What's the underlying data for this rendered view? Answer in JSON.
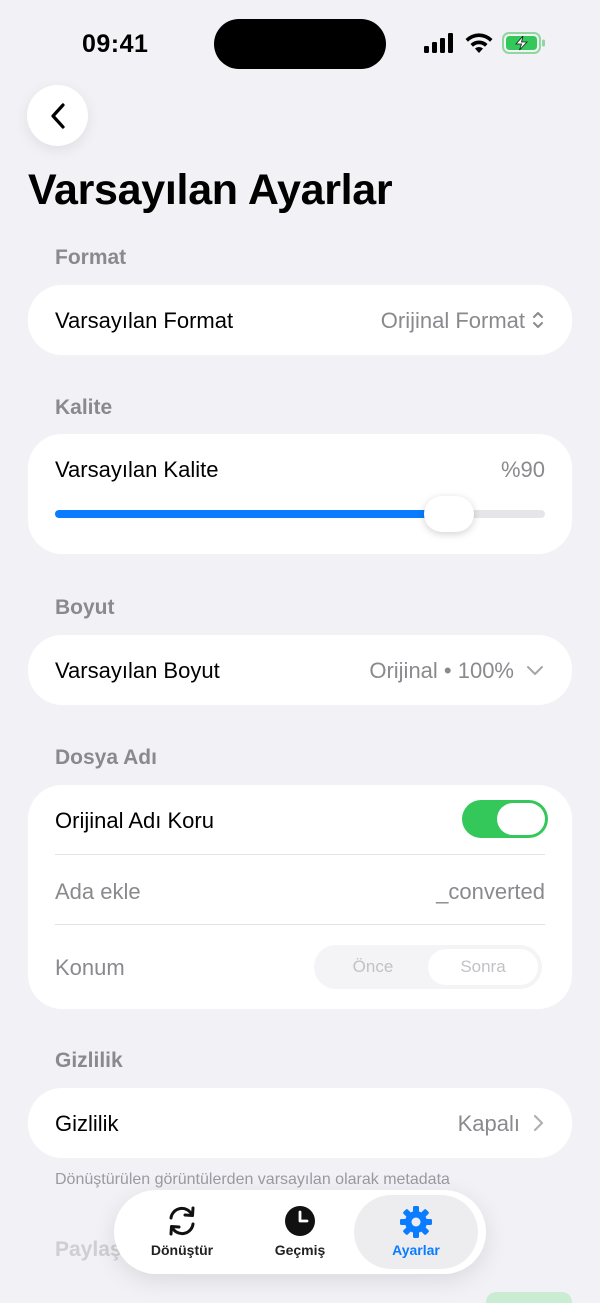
{
  "status_bar": {
    "time": "09:41"
  },
  "page": {
    "title": "Varsayılan Ayarlar"
  },
  "format": {
    "section": "Format",
    "label": "Varsayılan Format",
    "value": "Orijinal Format"
  },
  "quality": {
    "section": "Kalite",
    "label": "Varsayılan Kalite",
    "value": "%90",
    "level_fraction": 0.8
  },
  "size": {
    "section": "Boyut",
    "label": "Varsayılan Boyut",
    "value": "Orijinal • 100%"
  },
  "filename": {
    "section": "Dosya Adı",
    "keep_original_label": "Orijinal Adı Koru",
    "keep_original_on": true,
    "suffix_label": "Ada ekle",
    "suffix_value": "_converted",
    "position_label": "Konum",
    "position_options": [
      "Önce",
      "Sonra"
    ],
    "position_selected": "Sonra"
  },
  "privacy": {
    "section": "Gizlilik",
    "label": "Gizlilik",
    "value": "Kapalı",
    "footnote": "Dönüştürülen görüntülerden varsayılan olarak metadata"
  },
  "next_section_partial": "Paylaş",
  "tab_bar": {
    "tabs": [
      {
        "label": "Dönüştür",
        "icon": "convert-icon",
        "active": false
      },
      {
        "label": "Geçmiş",
        "icon": "clock-icon",
        "active": false
      },
      {
        "label": "Ayarlar",
        "icon": "gear-icon",
        "active": true
      }
    ]
  },
  "colors": {
    "accent": "#0a7cff",
    "toggle_on": "#34c759",
    "background": "#f2f2f6",
    "secondary_text": "#8a8a8e"
  }
}
